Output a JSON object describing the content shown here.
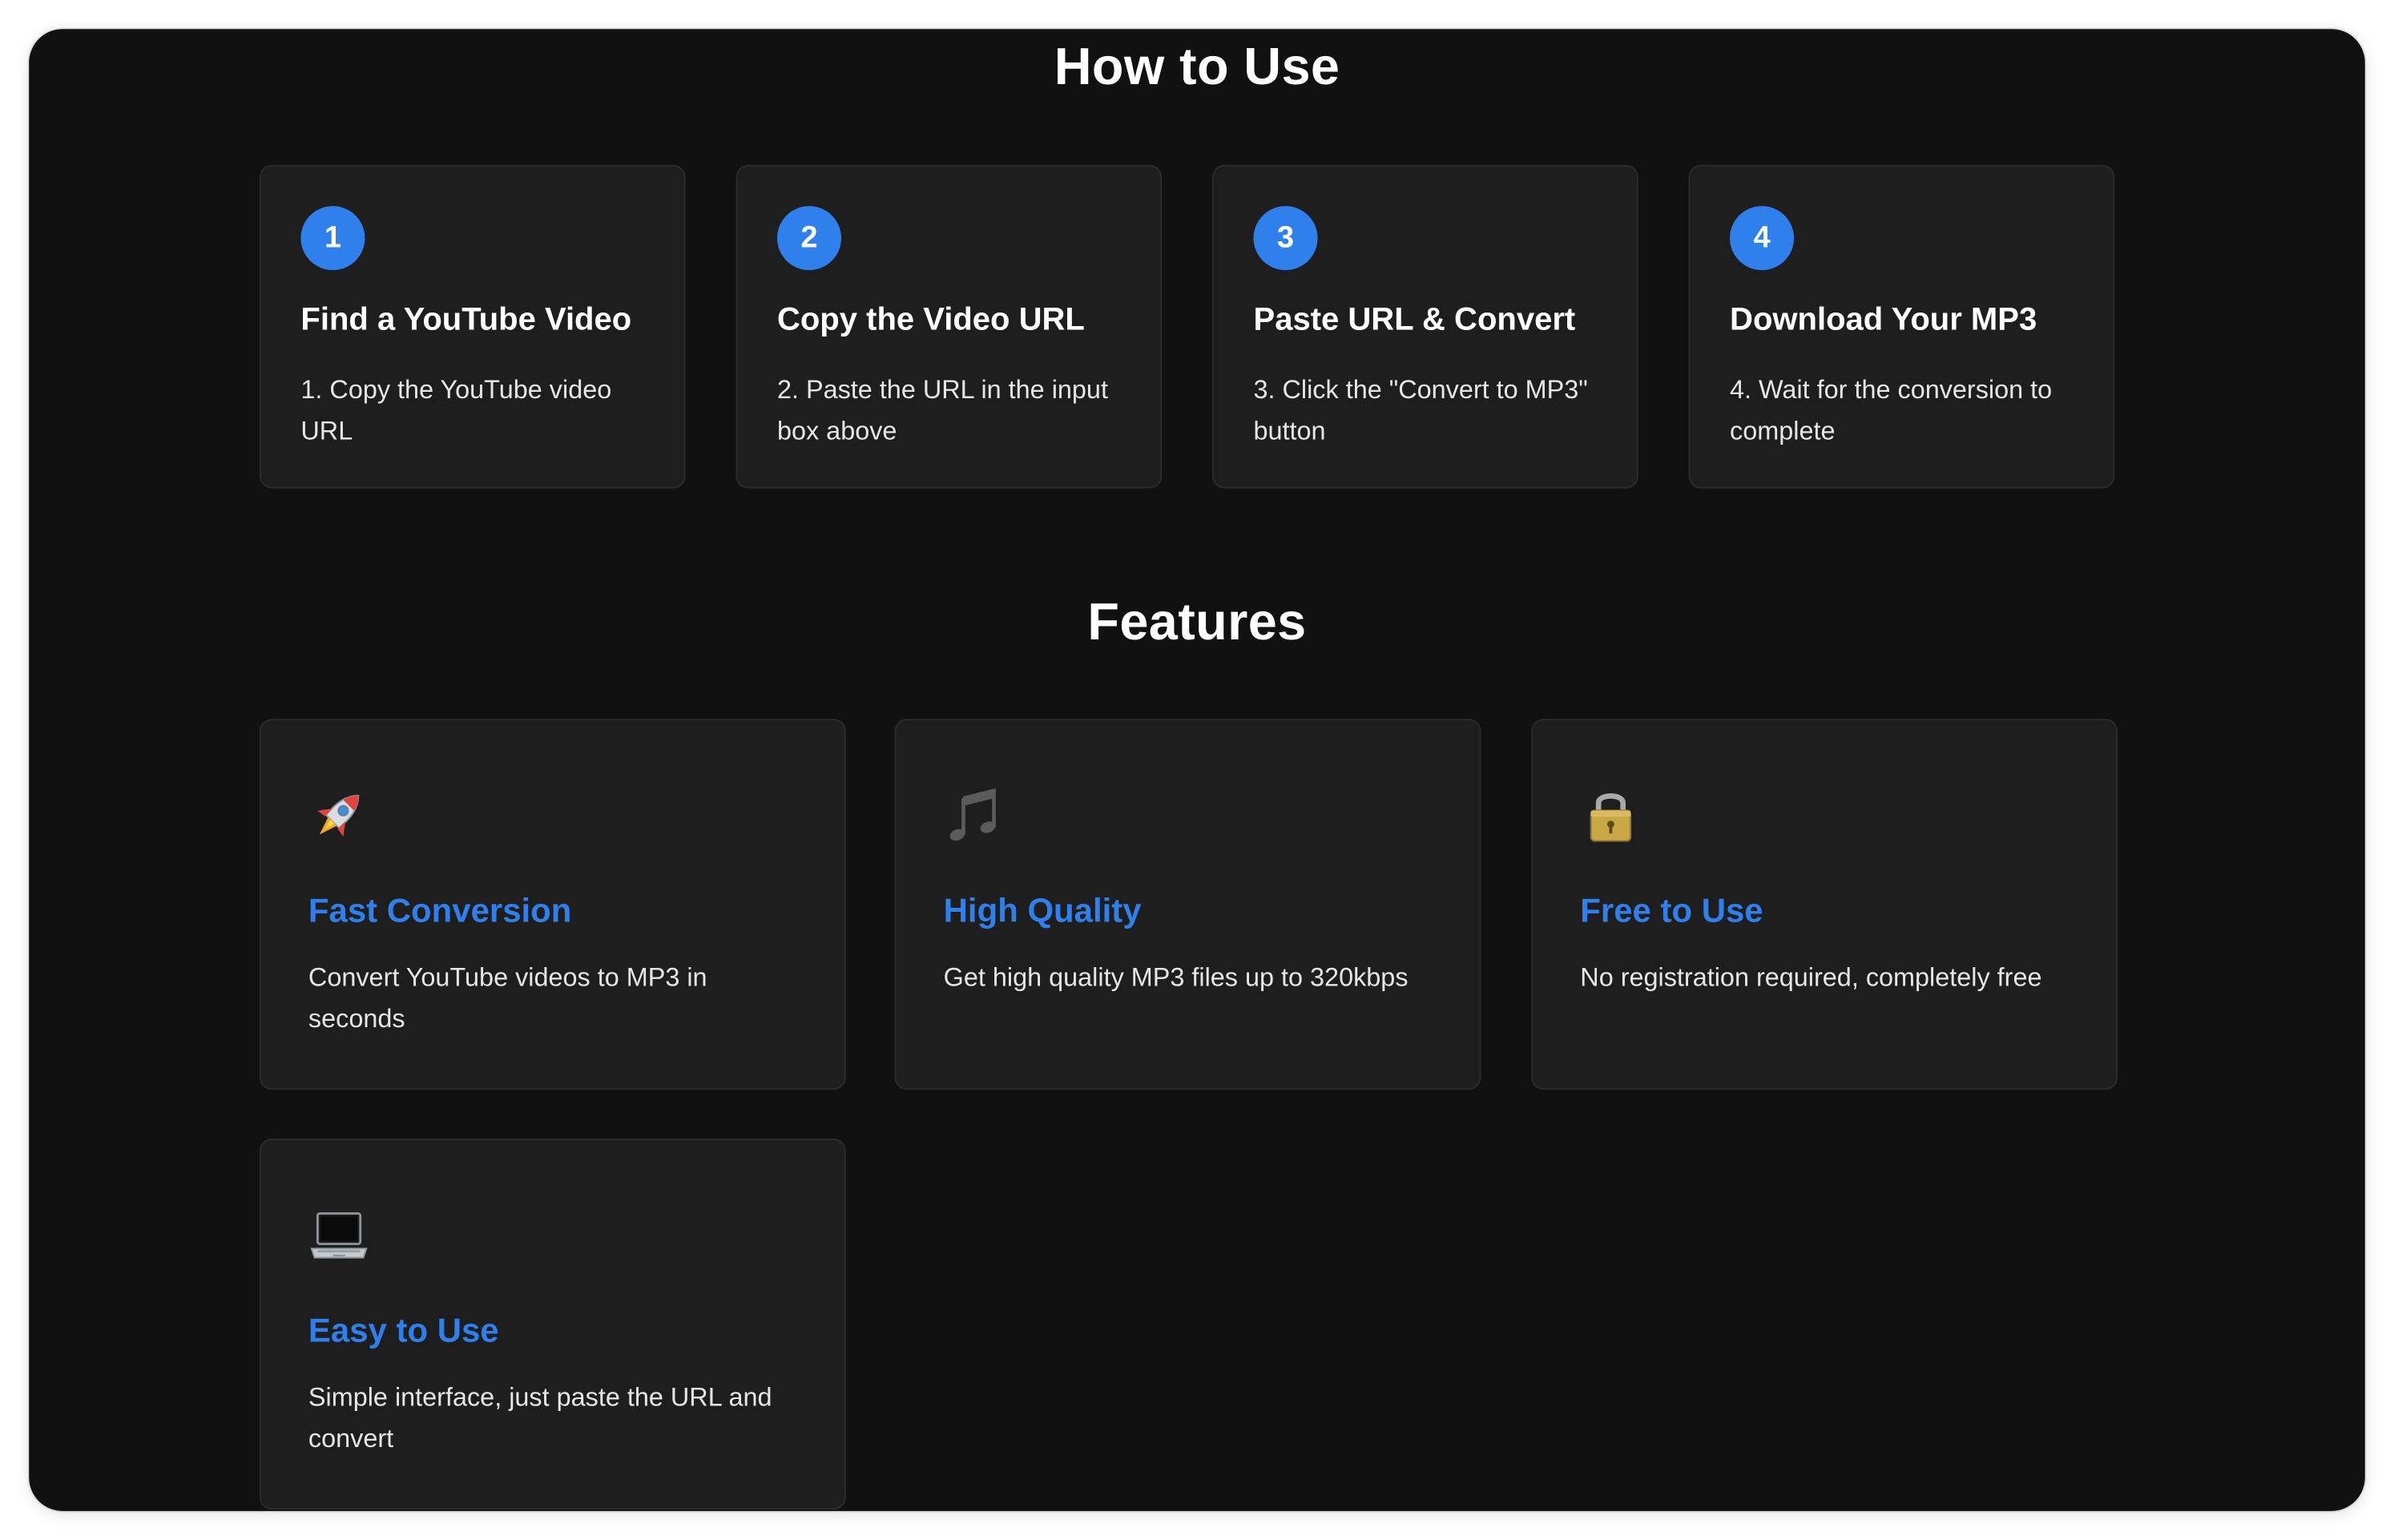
{
  "how_to_use": {
    "title": "How to Use",
    "steps": [
      {
        "number": "1",
        "title": "Find a YouTube Video",
        "description": "1. Copy the YouTube video URL"
      },
      {
        "number": "2",
        "title": "Copy the Video URL",
        "description": "2. Paste the URL in the input box above"
      },
      {
        "number": "3",
        "title": "Paste URL & Convert",
        "description": "3. Click the \"Convert to MP3\" button"
      },
      {
        "number": "4",
        "title": "Download Your MP3",
        "description": "4. Wait for the conversion to complete"
      }
    ]
  },
  "features": {
    "title": "Features",
    "items": [
      {
        "icon": "rocket-icon",
        "title": "Fast Conversion",
        "description": "Convert YouTube videos to MP3 in seconds"
      },
      {
        "icon": "music-note-icon",
        "title": "High Quality",
        "description": "Get high quality MP3 files up to 320kbps"
      },
      {
        "icon": "lock-icon",
        "title": "Free to Use",
        "description": "No registration required, completely free"
      },
      {
        "icon": "laptop-icon",
        "title": "Easy to Use",
        "description": "Simple interface, just paste the URL and convert"
      }
    ]
  },
  "colors": {
    "background": "#111111",
    "card": "#1e1e1e",
    "accent": "#2f80ed",
    "text": "#ffffff"
  }
}
